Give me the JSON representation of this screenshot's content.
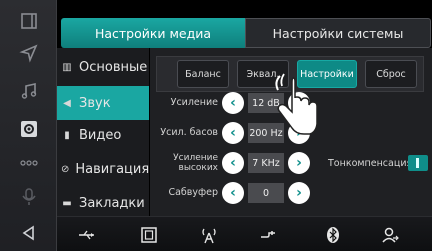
{
  "tabs": {
    "media": "Настройки медиа",
    "system": "Настройки системы"
  },
  "menu": [
    {
      "label": "Основные",
      "icon": "sliders-icon"
    },
    {
      "label": "Звук",
      "icon": "speaker-icon",
      "active": true
    },
    {
      "label": "Видео",
      "icon": "film-icon"
    },
    {
      "label": "Навигация",
      "icon": "compass-icon"
    },
    {
      "label": "Закладки",
      "icon": "bookmark-icon"
    }
  ],
  "subtabs": [
    {
      "label": "Баланс"
    },
    {
      "label": "Эквал."
    },
    {
      "label": "Настройки",
      "active": true
    },
    {
      "label": "Сброс"
    }
  ],
  "rows": [
    {
      "label": "Усиление",
      "value": "12 dB"
    },
    {
      "label": "Усил. басов",
      "value": "200 Hz"
    },
    {
      "label": "Усиление высоких",
      "value": "7 KHz"
    },
    {
      "label": "Сабвуфер",
      "value": "0"
    }
  ],
  "tone_compensation": "Тонкомпенсация",
  "colors": {
    "accent": "#1aa7a2",
    "active_bg": "#0e8a86"
  }
}
